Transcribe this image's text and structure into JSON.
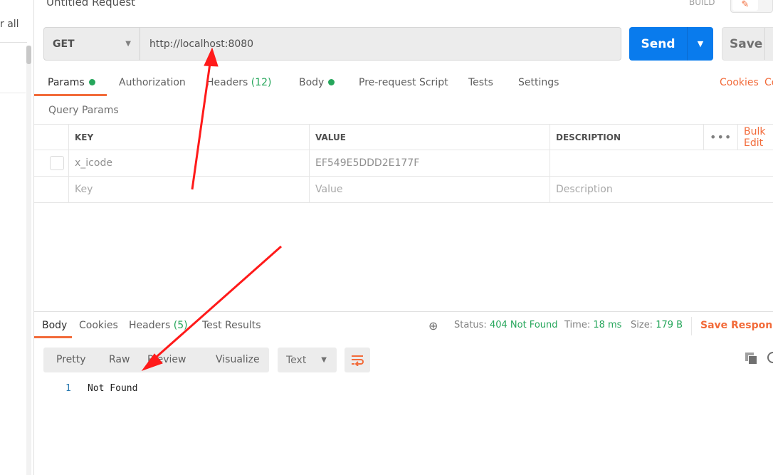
{
  "sidebar": {
    "partial_label": "r all"
  },
  "request": {
    "title": "Untitled Request",
    "build_label": "BUILD",
    "method": "GET",
    "url": "http://localhost:8080",
    "send_label": "Send",
    "save_label": "Save"
  },
  "request_tabs": [
    {
      "label": "Params",
      "dot": true
    },
    {
      "label": "Authorization"
    },
    {
      "label": "Headers",
      "count": "(12)"
    },
    {
      "label": "Body",
      "dot": true
    },
    {
      "label": "Pre-request Script"
    },
    {
      "label": "Tests"
    },
    {
      "label": "Settings"
    }
  ],
  "links": {
    "cookies": "Cookies",
    "code": "Code"
  },
  "query_params": {
    "title": "Query Params",
    "columns": [
      "KEY",
      "VALUE",
      "DESCRIPTION"
    ],
    "bulk_edit": "Bulk Edit",
    "rows": [
      {
        "key": "x_icode",
        "value": "EF549E5DDD2E177F",
        "description": ""
      }
    ],
    "placeholders": {
      "key": "Key",
      "value": "Value",
      "description": "Description"
    }
  },
  "response": {
    "tabs": [
      {
        "label": "Body"
      },
      {
        "label": "Cookies"
      },
      {
        "label": "Headers",
        "count": "(5)"
      },
      {
        "label": "Test Results"
      }
    ],
    "status_label": "Status:",
    "status": "404 Not Found",
    "time_label": "Time:",
    "time": "18 ms",
    "size_label": "Size:",
    "size": "179 B",
    "save_response": "Save Response",
    "views": [
      "Pretty",
      "Raw",
      "Preview",
      "Visualize"
    ],
    "format": "Text",
    "lines": [
      {
        "n": "1",
        "text": "Not Found"
      }
    ]
  },
  "colors": {
    "accent": "#f26b3a",
    "send": "#097bed",
    "success": "#26a65b",
    "annotation": "#ff1a1a"
  }
}
